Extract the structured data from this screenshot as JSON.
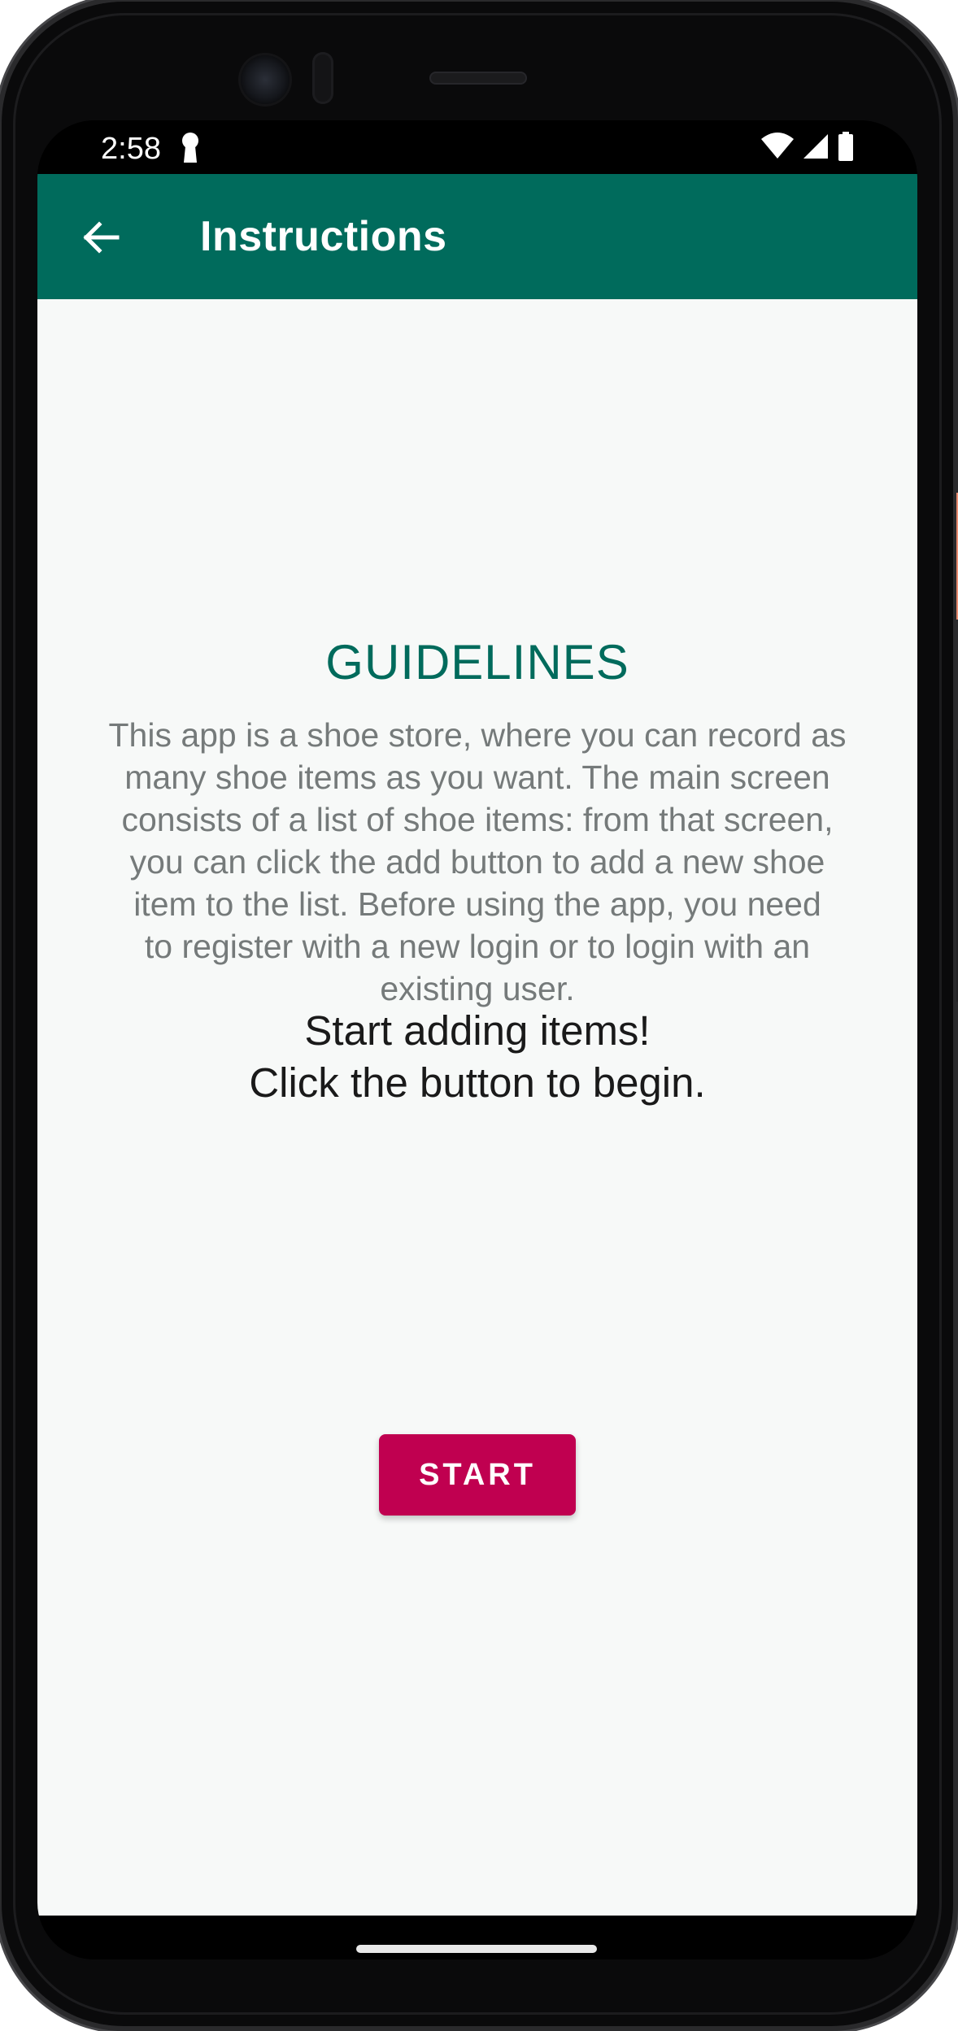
{
  "status_bar": {
    "time": "2:58",
    "icons": [
      "lock-keyhole-icon",
      "wifi-icon",
      "signal-icon",
      "battery-icon"
    ]
  },
  "app_bar": {
    "title": "Instructions",
    "back_icon": "arrow-back-icon",
    "background": "#006b5c"
  },
  "content": {
    "heading": "GUIDELINES",
    "body_lines": [
      "This app is a shoe store, where you can record as",
      "many shoe items as you want. The main screen",
      "consists of a list of shoe items: from that screen,",
      "you can click the add button to add a new shoe",
      "item to the list. Before using the app, you need",
      "to register with a new login or to login with an",
      "existing user."
    ],
    "start_line_1": "Start adding items!",
    "start_line_2": "Click the button to begin.",
    "start_button_label": "START",
    "accent_color": "#006b5c",
    "button_color": "#c00050"
  }
}
